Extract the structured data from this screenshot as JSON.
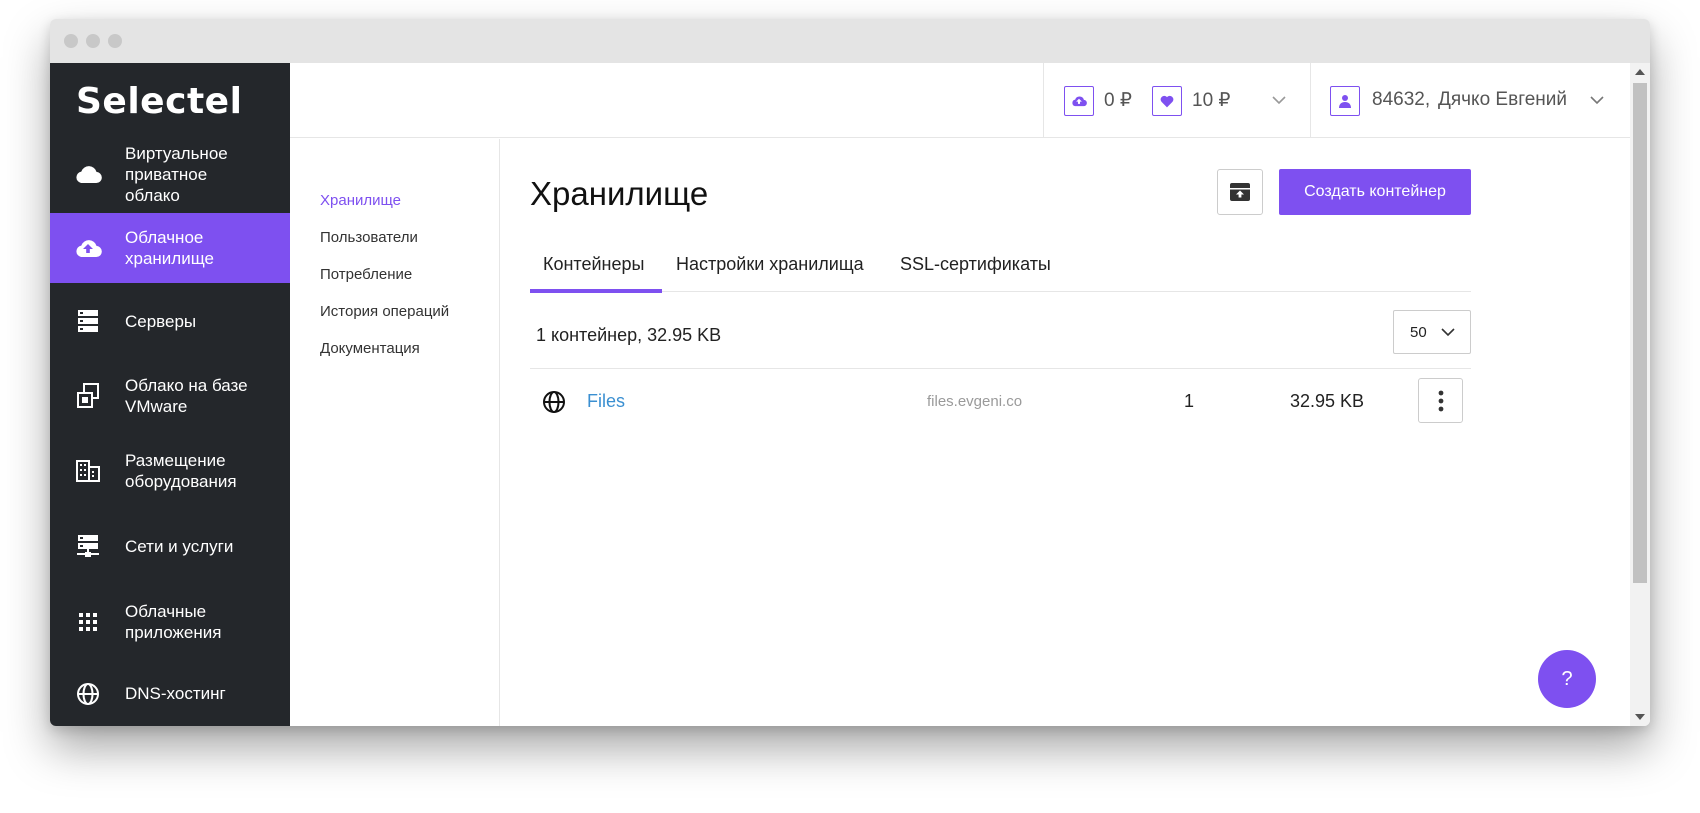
{
  "sidebar": {
    "logo": "Selectel",
    "items": [
      {
        "label": "Виртуальное\nприватное\nоблако",
        "icon": "cloud-icon"
      },
      {
        "label": "Облачное\nхранилище",
        "icon": "cloud-upload-icon",
        "active": true
      },
      {
        "label": "Серверы",
        "icon": "servers-icon"
      },
      {
        "label": "Облако на базе\nVMware",
        "icon": "vmware-icon"
      },
      {
        "label": "Размещение\nоборудования",
        "icon": "building-icon"
      },
      {
        "label": "Сети и услуги",
        "icon": "network-icon"
      },
      {
        "label": "Облачные\nприложения",
        "icon": "apps-grid-icon"
      },
      {
        "label": "DNS-хостинг",
        "icon": "globe-icon"
      }
    ]
  },
  "header": {
    "balance": "0 ₽",
    "bonus": "10 ₽",
    "account_id": "84632,",
    "user_name": "Дячко Евгений"
  },
  "subnav": {
    "items": [
      "Хранилище",
      "Пользователи",
      "Потребление",
      "История операций",
      "Документация"
    ]
  },
  "main": {
    "title": "Хранилище",
    "create_label": "Создать контейнер",
    "tabs": [
      "Контейнеры",
      "Настройки хранилища",
      "SSL-сертификаты"
    ],
    "summary": "1 контейнер, 32.95 KB",
    "page_size": "50",
    "containers": [
      {
        "name": "Files",
        "domain": "files.evgeni.co",
        "objects": "1",
        "size": "32.95 KB"
      }
    ]
  },
  "help_label": "?",
  "colors": {
    "accent": "#7e50f0",
    "sidebar": "#24272b",
    "link": "#3a8fd1"
  }
}
